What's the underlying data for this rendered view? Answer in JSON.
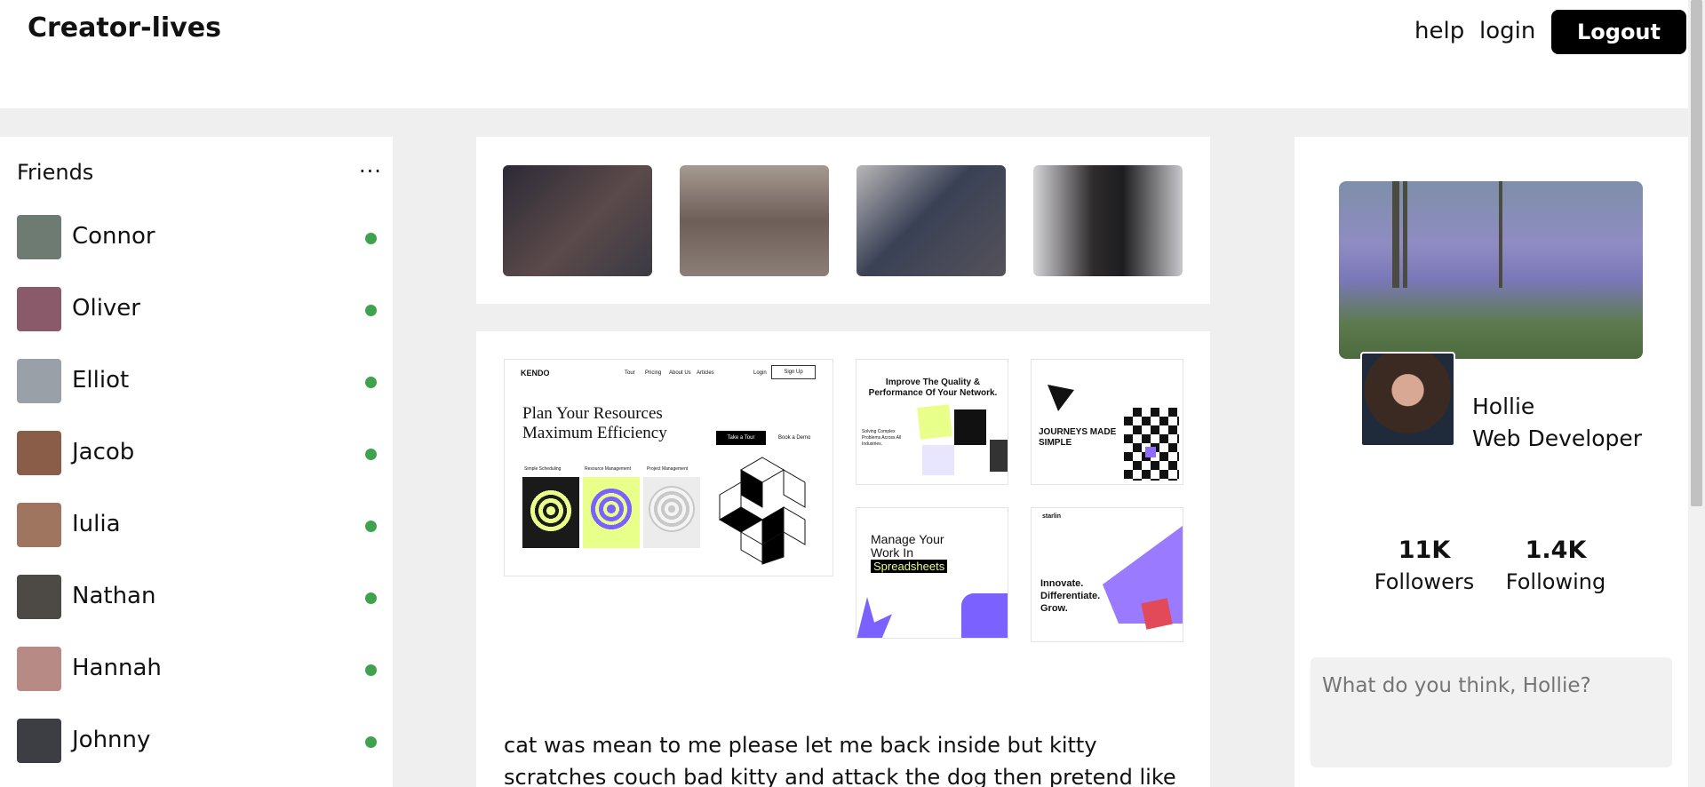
{
  "header": {
    "brand": "Creator-lives",
    "nav": {
      "help": "help",
      "login": "login",
      "logout": "Logout"
    }
  },
  "friends": {
    "title": "Friends",
    "more": "...",
    "items": [
      {
        "name": "Connor",
        "color": "#6d7b73"
      },
      {
        "name": "Oliver",
        "color": "#8a5a6a"
      },
      {
        "name": "Elliot",
        "color": "#9aa0a8"
      },
      {
        "name": "Jacob",
        "color": "#8a5d48"
      },
      {
        "name": "Iulia",
        "color": "#a07560"
      },
      {
        "name": "Nathan",
        "color": "#4d4a45"
      },
      {
        "name": "Hannah",
        "color": "#b88a86"
      },
      {
        "name": "Johnny",
        "color": "#3d3d44"
      }
    ],
    "online_color": "#3fa34d"
  },
  "stories": [
    {
      "color": "#3a3340"
    },
    {
      "color": "#8a7a70"
    },
    {
      "color": "#6f6b70"
    },
    {
      "color": "#4d4a4c"
    }
  ],
  "post": {
    "mock_main": {
      "logo": "KENDO",
      "nav": [
        "Tour",
        "Pricing",
        "About Us",
        "Articles"
      ],
      "login": "Login",
      "signup": "Sign Up",
      "headline1": "Plan Your Resources",
      "headline2": "Maximum Efficiency",
      "cta": "Take a Tour",
      "cta2": "Book a Demo",
      "tags": [
        "Simple Scheduling",
        "Resource Management",
        "Project Management"
      ]
    },
    "mock_network": {
      "title": "Improve The Quality & Performance Of Your Network.",
      "sub": "Solving Complex Problems Across All Industries."
    },
    "mock_journeys": {
      "title": "JOURNEYS MADE SIMPLE"
    },
    "mock_manage": {
      "line1": "Manage Your",
      "line2": "Work In",
      "line3": "Spreadsheets"
    },
    "mock_starlin": {
      "logo": "starlin",
      "title": "Innovate. Differentiate. Grow."
    },
    "text": "cat was mean to me please let me back inside but kitty scratches couch bad kitty and attack the dog then pretend like nothing"
  },
  "profile": {
    "name": "Hollie",
    "role": "Web Developer",
    "followers_count": "11K",
    "followers_label": "Followers",
    "following_count": "1.4K",
    "following_label": "Following",
    "composer_placeholder": "What do you think, Hollie?"
  }
}
